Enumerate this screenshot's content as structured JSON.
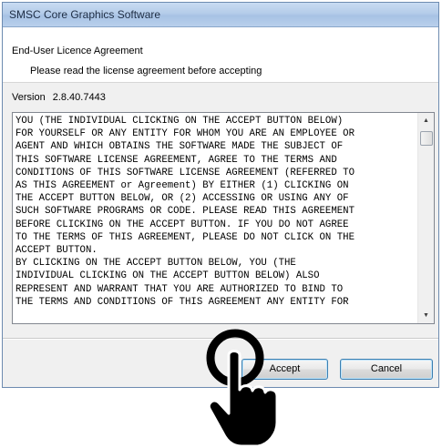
{
  "window": {
    "title": "SMSC Core Graphics Software"
  },
  "header": {
    "title": "End-User Licence Agreement",
    "subtitle": "Please read the license agreement before accepting"
  },
  "version": {
    "label": "Version",
    "value": "2.8.40.7443"
  },
  "license": {
    "text": "YOU (THE INDIVIDUAL CLICKING ON THE ACCEPT BUTTON BELOW)\nFOR YOURSELF OR ANY ENTITY FOR WHOM YOU ARE AN EMPLOYEE OR\nAGENT AND WHICH OBTAINS THE SOFTWARE MADE THE SUBJECT OF\nTHIS SOFTWARE LICENSE AGREEMENT, AGREE TO THE TERMS AND\nCONDITIONS OF THIS SOFTWARE LICENSE AGREEMENT (REFERRED TO\nAS THIS AGREEMENT or Agreement) BY EITHER (1) CLICKING ON\nTHE ACCEPT BUTTON BELOW, OR (2) ACCESSING OR USING ANY OF\nSUCH SOFTWARE PROGRAMS OR CODE. PLEASE READ THIS AGREEMENT\nBEFORE CLICKING ON THE ACCEPT BUTTON. IF YOU DO NOT AGREE\nTO THE TERMS OF THIS AGREEMENT, PLEASE DO NOT CLICK ON THE\nACCEPT BUTTON.\nBY CLICKING ON THE ACCEPT BUTTON BELOW, YOU (THE\nINDIVIDUAL CLICKING ON THE ACCEPT BUTTON BELOW) ALSO\nREPRESENT AND WARRANT THAT YOU ARE AUTHORIZED TO BIND TO\nTHE TERMS AND CONDITIONS OF THIS AGREEMENT ANY ENTITY FOR"
  },
  "buttons": {
    "accept_label": "Accept",
    "cancel_label": "Cancel"
  },
  "icons": {
    "scroll_up": "scroll-up-arrow-icon",
    "scroll_down": "scroll-down-arrow-icon",
    "pointer": "pointing-hand-icon"
  },
  "colors": {
    "titlebar": "#b4cce9",
    "button_border": "#3c7fb1"
  }
}
